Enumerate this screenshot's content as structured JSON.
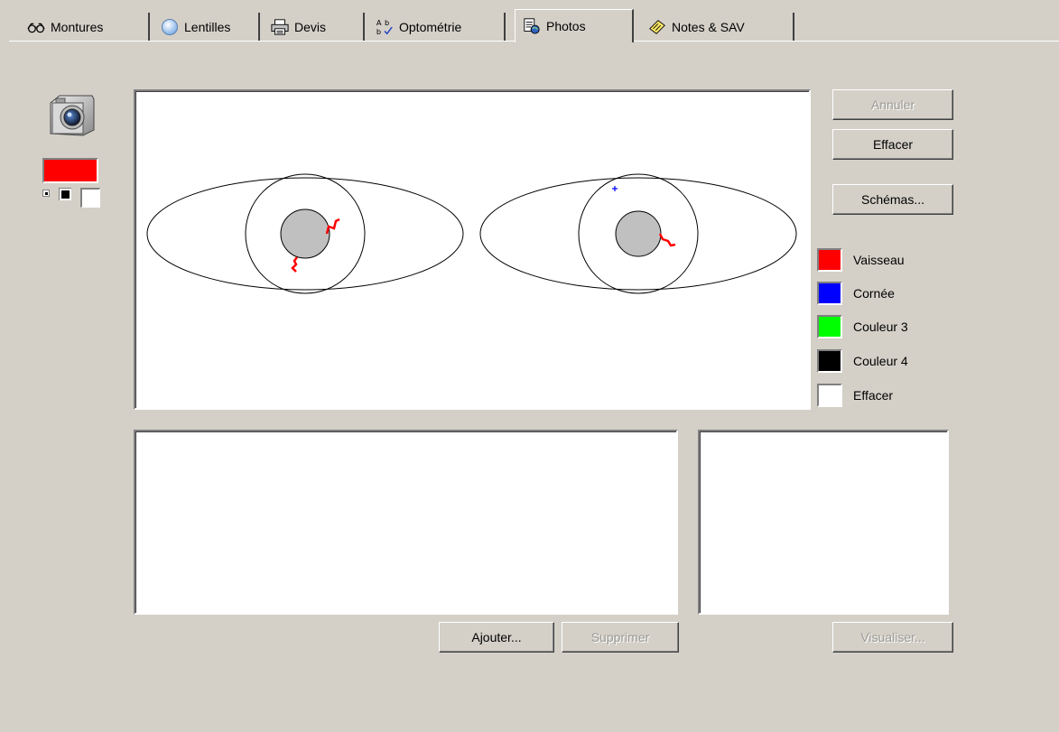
{
  "tabs": [
    {
      "label": "Montures",
      "icon": "glasses-icon"
    },
    {
      "label": "Lentilles",
      "icon": "lens-icon"
    },
    {
      "label": "Devis",
      "icon": "printer-icon"
    },
    {
      "label": "Optométrie",
      "icon": "spelling-icon"
    },
    {
      "label": "Photos",
      "icon": "photo-document-icon",
      "selected": true
    },
    {
      "label": "Notes & SAV",
      "icon": "notes-icon"
    }
  ],
  "tools": {
    "camera_icon": "camera-icon",
    "current_color": "#ff0000"
  },
  "buttons": {
    "annuler": "Annuler",
    "effacer": "Effacer",
    "schemas": "Schémas...",
    "ajouter": "Ajouter...",
    "supprimer": "Supprimer",
    "visualiser": "Visualiser..."
  },
  "legend": [
    {
      "label": "Vaisseau",
      "color": "#ff0000"
    },
    {
      "label": "Cornée",
      "color": "#0000ff"
    },
    {
      "label": "Couleur 3",
      "color": "#00ff00"
    },
    {
      "label": "Couleur 4",
      "color": "#000000"
    },
    {
      "label": "Effacer",
      "color": "#ffffff"
    }
  ],
  "drawing": {
    "iris_color": "#c0c0c0",
    "vessel_color": "#ff0000",
    "cornea_mark_color": "#0000ff"
  }
}
